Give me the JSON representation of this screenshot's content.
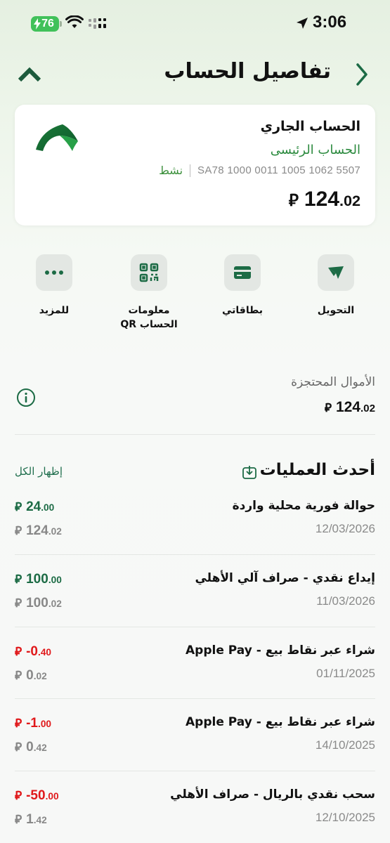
{
  "status_bar": {
    "battery_level": "76",
    "time": "3:06",
    "icons": [
      "charging-bolt-icon",
      "wifi-icon",
      "cellular-signal-icon",
      "location-arrow-icon"
    ]
  },
  "header": {
    "title": "تفاصيل الحساب",
    "back_icon": "chevron-right-icon",
    "collapse_icon": "chevron-up-icon"
  },
  "account": {
    "type": "الحساب الجاري",
    "name": "الحساب الرئيسى",
    "iban": "SA78 1000 0011 1005 1062 5507",
    "status": "نشط",
    "currency_symbol": "⃁",
    "balance_int": "124",
    "balance_dec": ".02"
  },
  "actions": [
    {
      "label": "التحويل",
      "icon": "transfer-arrow-icon"
    },
    {
      "label": "بطاقاتي",
      "icon": "card-icon"
    },
    {
      "label": "معلومات\nالحساب QR",
      "icon": "qr-code-icon"
    },
    {
      "label": "للمزيد",
      "icon": "more-dots-icon"
    }
  ],
  "reserved": {
    "title": "الأموال المحتجزة",
    "amount_int": "124",
    "amount_dec": ".02"
  },
  "transactions": {
    "title": "أحدث العمليات",
    "show_all": "إظهار الكل",
    "items": [
      {
        "desc": "حوالة فورية محلية واردة",
        "date": "12/03/2026",
        "amount_int": "24",
        "amount_dec": ".00",
        "balance_int": "124",
        "balance_dec": ".02",
        "direction": "credit"
      },
      {
        "desc": "إيداع نقدي - صراف آلي الأهلي",
        "date": "11/03/2026",
        "amount_int": "100",
        "amount_dec": ".00",
        "balance_int": "100",
        "balance_dec": ".02",
        "direction": "credit"
      },
      {
        "desc": "شراء عبر نقاط بيع - Apple Pay",
        "date": "01/11/2025",
        "amount_int": "-0",
        "amount_dec": ".40",
        "balance_int": "0",
        "balance_dec": ".02",
        "direction": "debit"
      },
      {
        "desc": "شراء عبر نقاط بيع - Apple Pay",
        "date": "14/10/2025",
        "amount_int": "-1",
        "amount_dec": ".00",
        "balance_int": "0",
        "balance_dec": ".42",
        "direction": "debit"
      },
      {
        "desc": "سحب نقدي بالريال - صراف الأهلي",
        "date": "12/10/2025",
        "amount_int": "-50",
        "amount_dec": ".00",
        "balance_int": "1",
        "balance_dec": ".42",
        "direction": "debit"
      }
    ]
  },
  "colors": {
    "brand_green": "#1c6b45",
    "accent_green": "#2b8a3e",
    "debit_red": "#e0191b"
  }
}
